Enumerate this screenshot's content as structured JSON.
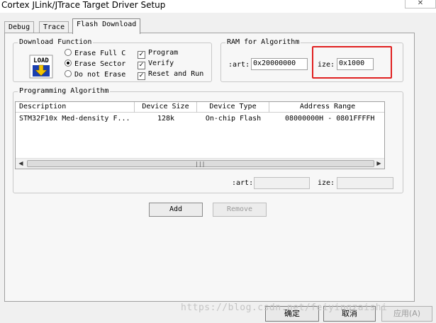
{
  "window": {
    "title": "Cortex JLink/JTrace Target Driver Setup",
    "close_glyph": "✕"
  },
  "tabs": [
    {
      "label": "Debug"
    },
    {
      "label": "Trace"
    },
    {
      "label": "Flash Download"
    }
  ],
  "download_function": {
    "legend": "Download Function",
    "icon_text": "LOAD",
    "radios": [
      {
        "label": "Erase Full C",
        "selected": false
      },
      {
        "label": "Erase Sector",
        "selected": true
      },
      {
        "label": "Do not Erase",
        "selected": false
      }
    ],
    "checks": [
      {
        "label": "Program",
        "checked": true
      },
      {
        "label": "Verify",
        "checked": true
      },
      {
        "label": "Reset and Run",
        "checked": true
      }
    ]
  },
  "ram_for_algorithm": {
    "legend": "RAM for Algorithm",
    "start_label": ":art:",
    "start_value": "0x20000000",
    "size_label": "ize:",
    "size_value": "0x1000"
  },
  "programming_algorithm": {
    "legend": "Programming Algorithm",
    "columns": [
      "Description",
      "Device Size",
      "Device Type",
      "Address Range"
    ],
    "rows": [
      {
        "description": "STM32F10x Med-density F...",
        "size": "128k",
        "type": "On-chip Flash",
        "range": "08000000H - 0801FFFFH"
      }
    ],
    "start_label": ":art:",
    "start_value": "",
    "size_label": "ize:",
    "size_value": ""
  },
  "buttons": {
    "add": "Add",
    "remove": "Remove",
    "ok": "确定",
    "cancel": "取消",
    "apply": "应用(A)"
  },
  "watermark": "https://blog.csdn.net/feiyingzaishi"
}
